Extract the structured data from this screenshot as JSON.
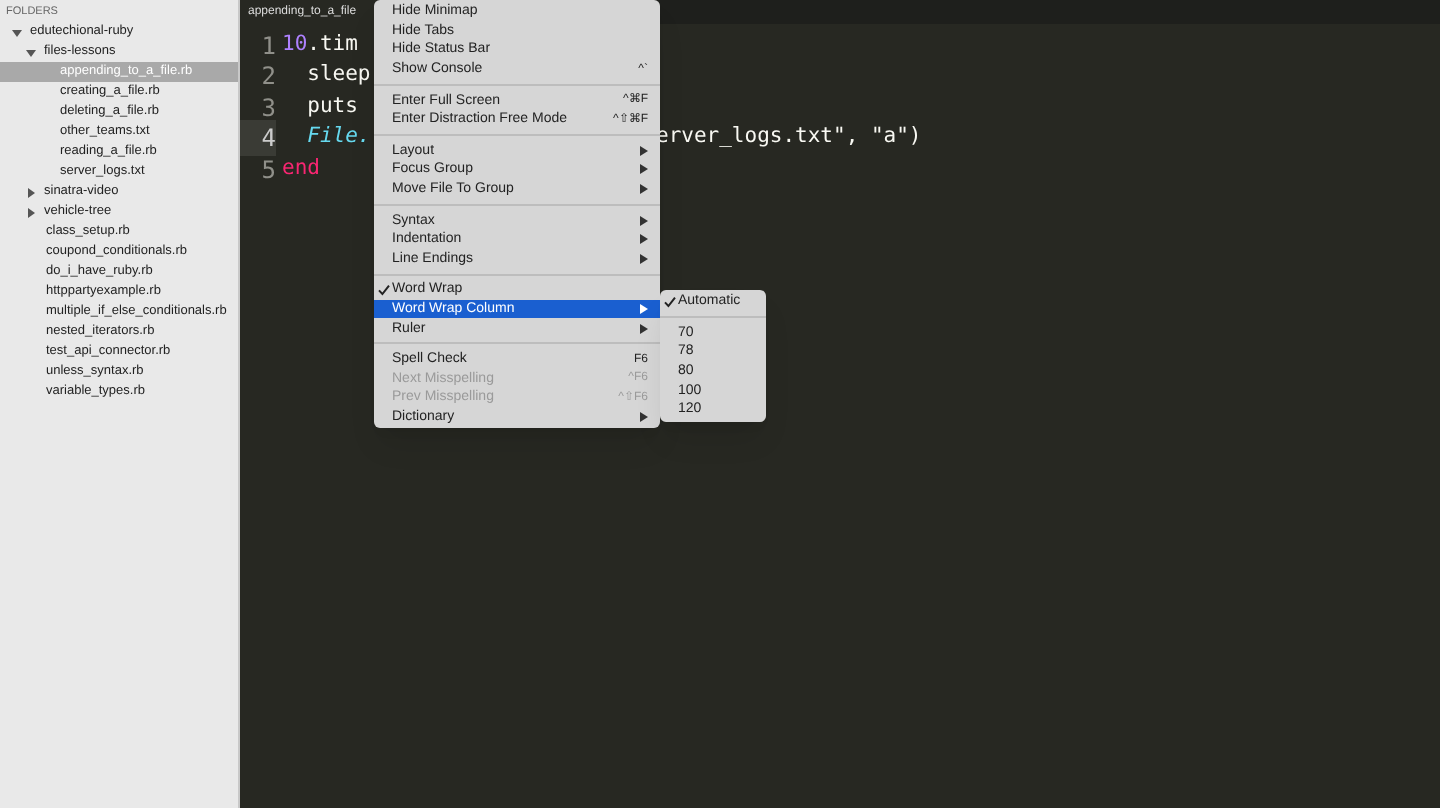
{
  "sidebar": {
    "title": "FOLDERS",
    "tree": [
      {
        "label": "edutechional-ruby",
        "kind": "folder",
        "expanded": true,
        "selected": false,
        "children": [
          {
            "label": "files-lessons",
            "kind": "folder",
            "expanded": true,
            "selected": false,
            "children": [
              {
                "label": "appending_to_a_file.rb",
                "kind": "file",
                "selected": true
              },
              {
                "label": "creating_a_file.rb",
                "kind": "file",
                "selected": false
              },
              {
                "label": "deleting_a_file.rb",
                "kind": "file",
                "selected": false
              },
              {
                "label": "other_teams.txt",
                "kind": "file",
                "selected": false
              },
              {
                "label": "reading_a_file.rb",
                "kind": "file",
                "selected": false
              },
              {
                "label": "server_logs.txt",
                "kind": "file",
                "selected": false
              }
            ]
          },
          {
            "label": "sinatra-video",
            "kind": "folder",
            "expanded": false,
            "selected": false
          },
          {
            "label": "vehicle-tree",
            "kind": "folder",
            "expanded": false,
            "selected": false
          },
          {
            "label": "class_setup.rb",
            "kind": "file",
            "selected": false
          },
          {
            "label": "coupond_conditionals.rb",
            "kind": "file",
            "selected": false
          },
          {
            "label": "do_i_have_ruby.rb",
            "kind": "file",
            "selected": false
          },
          {
            "label": "httppartyexample.rb",
            "kind": "file",
            "selected": false
          },
          {
            "label": "multiple_if_else_conditionals.rb",
            "kind": "file",
            "selected": false
          },
          {
            "label": "nested_iterators.rb",
            "kind": "file",
            "selected": false
          },
          {
            "label": "test_api_connector.rb",
            "kind": "file",
            "selected": false
          },
          {
            "label": "unless_syntax.rb",
            "kind": "file",
            "selected": false
          },
          {
            "label": "variable_types.rb",
            "kind": "file",
            "selected": false
          }
        ]
      }
    ]
  },
  "tab": {
    "label": "appending_to_a_file"
  },
  "code": [
    {
      "number": "1",
      "current": false,
      "tokens": [
        {
          "text": "10",
          "kind": "number"
        },
        {
          "text": ".tim",
          "kind": "plain"
        }
      ]
    },
    {
      "number": "2",
      "current": false,
      "tokens": [
        {
          "text": "  sleep",
          "kind": "plain"
        }
      ]
    },
    {
      "number": "3",
      "current": false,
      "tokens": [
        {
          "text": "  puts",
          "kind": "plain"
        }
      ]
    },
    {
      "number": "4",
      "current": true,
      "tokens": [
        {
          "text": "  File.",
          "kind": "class"
        }
      ],
      "tail": "erver_logs.txt\", \"a\")"
    },
    {
      "number": "5",
      "current": false,
      "tokens": [
        {
          "text": "end",
          "kind": "keyword"
        }
      ]
    }
  ],
  "menu": [
    {
      "kind": "item",
      "label": "Hide Minimap"
    },
    {
      "kind": "item",
      "label": "Hide Tabs"
    },
    {
      "kind": "item",
      "label": "Hide Status Bar"
    },
    {
      "kind": "item",
      "label": "Show Console",
      "shortcut": "^`"
    },
    {
      "kind": "separator"
    },
    {
      "kind": "item",
      "label": "Enter Full Screen",
      "shortcut": "^⌘F"
    },
    {
      "kind": "item",
      "label": "Enter Distraction Free Mode",
      "shortcut": "^⇧⌘F"
    },
    {
      "kind": "separator"
    },
    {
      "kind": "submenu",
      "label": "Layout"
    },
    {
      "kind": "submenu",
      "label": "Focus Group"
    },
    {
      "kind": "submenu",
      "label": "Move File To Group"
    },
    {
      "kind": "separator"
    },
    {
      "kind": "submenu",
      "label": "Syntax"
    },
    {
      "kind": "submenu",
      "label": "Indentation"
    },
    {
      "kind": "submenu",
      "label": "Line Endings"
    },
    {
      "kind": "separator"
    },
    {
      "kind": "item",
      "label": "Word Wrap",
      "checked": true
    },
    {
      "kind": "submenu",
      "label": "Word Wrap Column",
      "selected": true
    },
    {
      "kind": "submenu",
      "label": "Ruler"
    },
    {
      "kind": "separator"
    },
    {
      "kind": "item",
      "label": "Spell Check",
      "shortcut": "F6"
    },
    {
      "kind": "item",
      "label": "Next Misspelling",
      "shortcut": "^F6",
      "disabled": true
    },
    {
      "kind": "item",
      "label": "Prev Misspelling",
      "shortcut": "^⇧F6",
      "disabled": true
    },
    {
      "kind": "submenu",
      "label": "Dictionary"
    }
  ],
  "submenu": [
    {
      "kind": "item",
      "label": "Automatic",
      "checked": true
    },
    {
      "kind": "separator"
    },
    {
      "kind": "item",
      "label": "70",
      "checked": false
    },
    {
      "kind": "item",
      "label": "78",
      "checked": false
    },
    {
      "kind": "item",
      "label": "80",
      "checked": false
    },
    {
      "kind": "item",
      "label": "100",
      "checked": false
    },
    {
      "kind": "item",
      "label": "120",
      "checked": false
    }
  ]
}
